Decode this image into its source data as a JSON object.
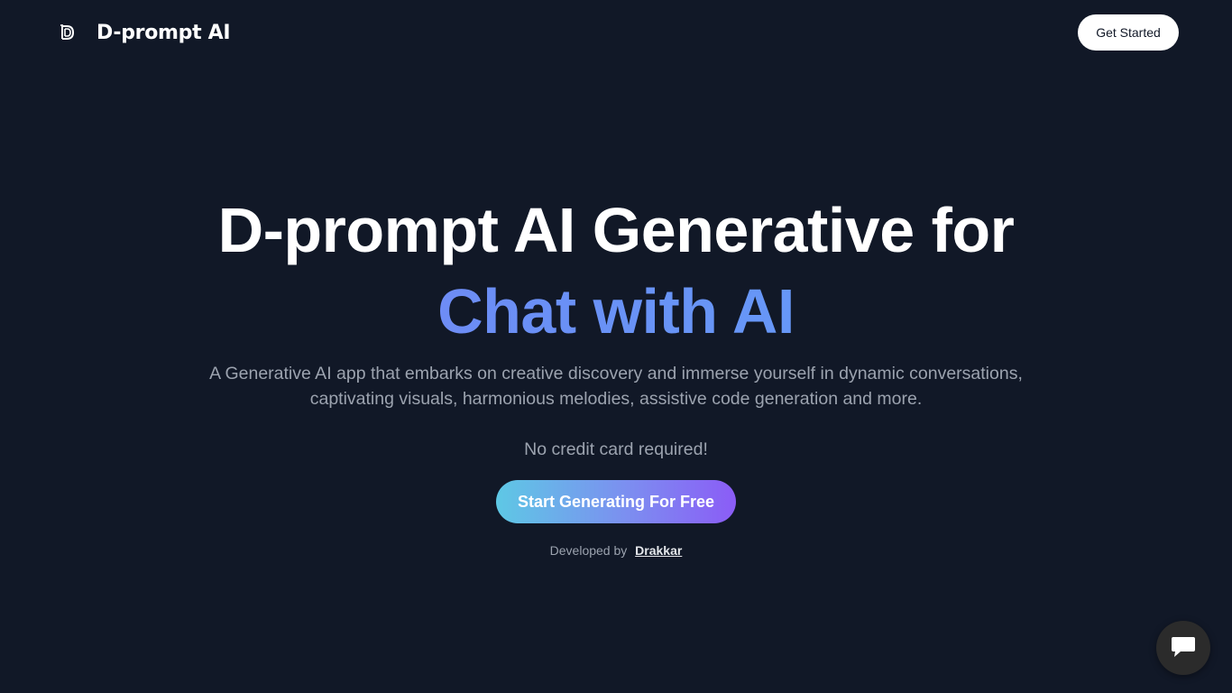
{
  "header": {
    "brand_name": "D-prompt AI",
    "logo_icon": "d-logo-icon",
    "cta_label": "Get Started"
  },
  "hero": {
    "title_line1": "D-prompt AI Generative for",
    "title_line2": "Chat with AI",
    "subtitle_line1": "A Generative AI app that embarks on creative discovery and immerse yourself in dynamic conversations,",
    "subtitle_line2": "captivating visuals, harmonious melodies, assistive code generation and more.",
    "note": "No credit card required!",
    "cta_label": "Start Generating For Free",
    "developed_by": "Developed by",
    "developer_name": "Drakkar"
  },
  "chat_widget": {
    "icon": "chat-bubble-icon"
  },
  "colors": {
    "background": "#111827",
    "title_gradient_start": "#8b80f9",
    "title_gradient_end": "#60a5fa",
    "cta_gradient_start": "#5ec8e5",
    "cta_gradient_end": "#8b5cf6"
  }
}
